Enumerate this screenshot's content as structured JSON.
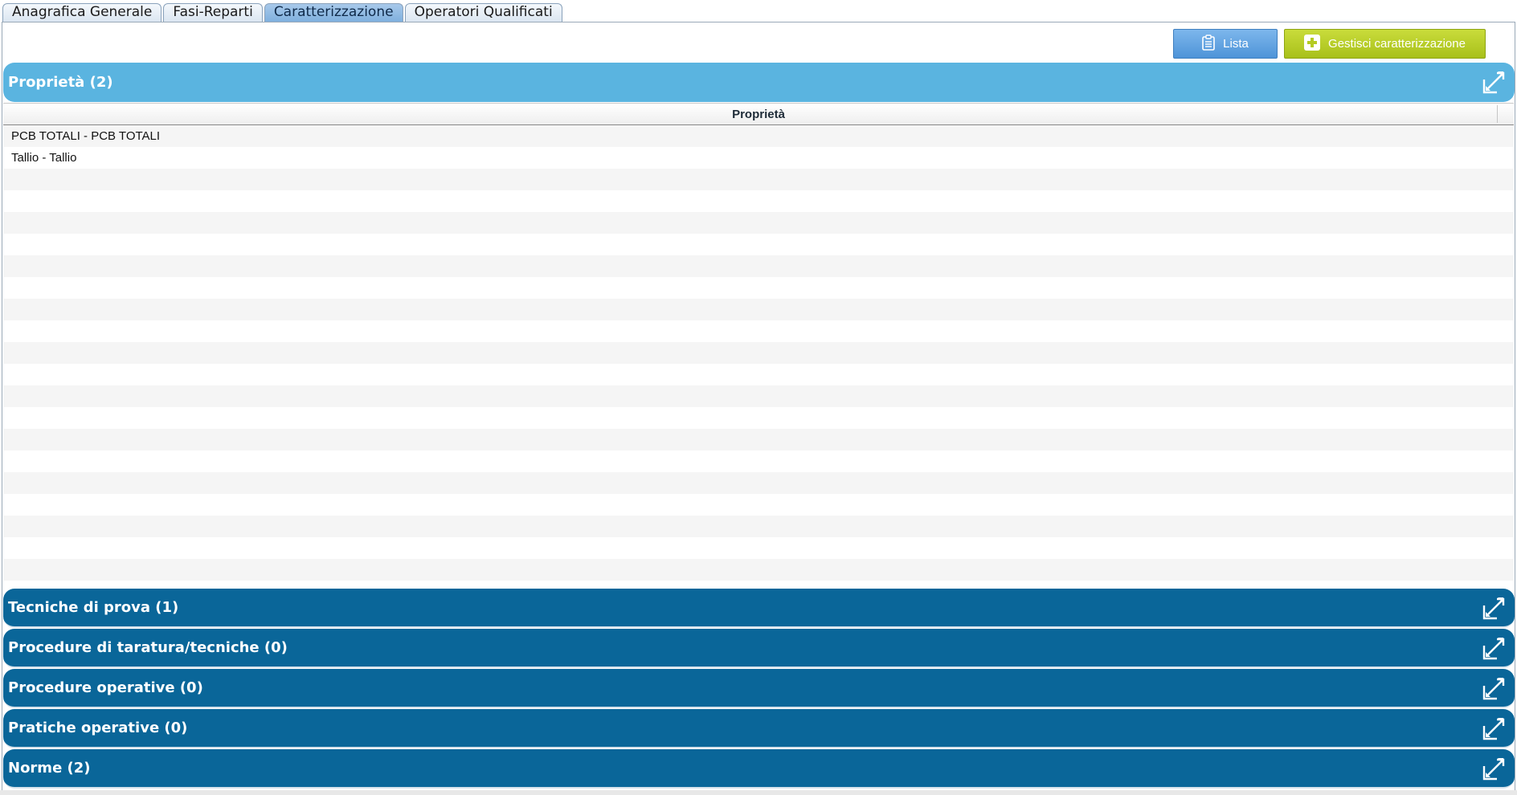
{
  "tabs": [
    {
      "label": "Anagrafica Generale",
      "active": false
    },
    {
      "label": "Fasi-Reparti",
      "active": false
    },
    {
      "label": "Caratterizzazione",
      "active": true
    },
    {
      "label": "Operatori Qualificati",
      "active": false
    }
  ],
  "toolbar": {
    "lista_label": "Lista",
    "gestisci_label": "Gestisci caratterizzazione"
  },
  "sections": {
    "proprieta": "Proprietà (2)",
    "tecniche": "Tecniche di prova (1)",
    "procedure_taratura": "Procedure di taratura/tecniche (0)",
    "procedure_operative": "Procedure operative (0)",
    "pratiche_operative": "Pratiche operative (0)",
    "norme": "Norme (2)"
  },
  "grid": {
    "column_header": "Proprietà",
    "rows": [
      "PCB TOTALI - PCB TOTALI",
      "Tallio - Tallio"
    ]
  },
  "colors": {
    "light_header": "#5ab4e0",
    "dark_header": "#0a6699",
    "lista_button": "#4e94d8",
    "gestisci_button": "#a8c01a",
    "active_tab": "#7fb0de"
  },
  "icons": {
    "expand": "expand-arrow-icon",
    "lista": "clipboard-list-icon",
    "gestisci": "plus-square-icon"
  }
}
